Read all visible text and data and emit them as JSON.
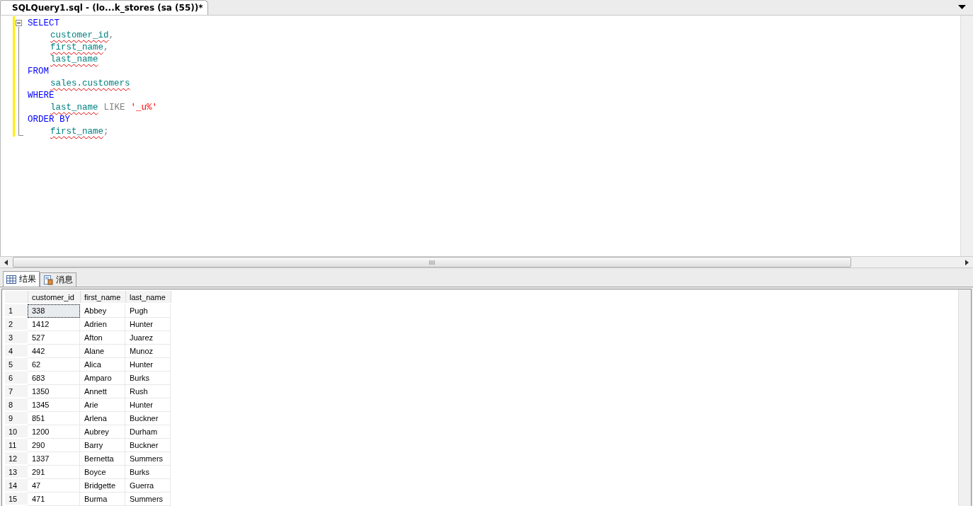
{
  "document_tab": {
    "title": "SQLQuery1.sql - (lo...k_stores (sa (55))*",
    "selected": true
  },
  "editor": {
    "folded": false,
    "lines": [
      {
        "indent": false,
        "tokens": [
          {
            "kind": "keyword",
            "text": "SELECT"
          }
        ]
      },
      {
        "indent": true,
        "tokens": [
          {
            "kind": "identifier",
            "text": "customer_id"
          },
          {
            "kind": "punct",
            "text": ","
          }
        ]
      },
      {
        "indent": true,
        "tokens": [
          {
            "kind": "identifier",
            "text": "first_name"
          },
          {
            "kind": "punct",
            "text": ","
          }
        ]
      },
      {
        "indent": true,
        "tokens": [
          {
            "kind": "identifier",
            "text": "last_name"
          }
        ]
      },
      {
        "indent": false,
        "tokens": [
          {
            "kind": "keyword",
            "text": "FROM"
          }
        ]
      },
      {
        "indent": true,
        "tokens": [
          {
            "kind": "identifier",
            "text": "sales.customers"
          }
        ]
      },
      {
        "indent": false,
        "tokens": [
          {
            "kind": "keyword",
            "text": "WHERE"
          }
        ]
      },
      {
        "indent": true,
        "tokens": [
          {
            "kind": "identifier",
            "text": "last_name"
          },
          {
            "kind": "operator",
            "text": "LIKE"
          },
          {
            "kind": "string",
            "text": "'_u%'"
          }
        ]
      },
      {
        "indent": false,
        "tokens": [
          {
            "kind": "keyword",
            "text": "ORDER BY"
          }
        ]
      },
      {
        "indent": true,
        "tokens": [
          {
            "kind": "identifier",
            "text": "first_name"
          },
          {
            "kind": "punct",
            "text": ";"
          }
        ]
      }
    ]
  },
  "result_tabs": [
    {
      "label": "结果",
      "kind": "grid",
      "selected": true
    },
    {
      "label": "消息",
      "kind": "messages",
      "selected": false
    }
  ],
  "grid": {
    "columns": [
      "customer_id",
      "first_name",
      "last_name"
    ],
    "rows": [
      {
        "number": "1",
        "cells": [
          "338",
          "Abbey",
          "Pugh"
        ],
        "focused": true
      },
      {
        "number": "2",
        "cells": [
          "1412",
          "Adrien",
          "Hunter"
        ],
        "focused": false
      },
      {
        "number": "3",
        "cells": [
          "527",
          "Afton",
          "Juarez"
        ],
        "focused": false
      },
      {
        "number": "4",
        "cells": [
          "442",
          "Alane",
          "Munoz"
        ],
        "focused": false
      },
      {
        "number": "5",
        "cells": [
          "62",
          "Alica",
          "Hunter"
        ],
        "focused": false
      },
      {
        "number": "6",
        "cells": [
          "683",
          "Amparo",
          "Burks"
        ],
        "focused": false
      },
      {
        "number": "7",
        "cells": [
          "1350",
          "Annett",
          "Rush"
        ],
        "focused": false
      },
      {
        "number": "8",
        "cells": [
          "1345",
          "Arie",
          "Hunter"
        ],
        "focused": false
      },
      {
        "number": "9",
        "cells": [
          "851",
          "Arlena",
          "Buckner"
        ],
        "focused": false
      },
      {
        "number": "10",
        "cells": [
          "1200",
          "Aubrey",
          "Durham"
        ],
        "focused": false
      },
      {
        "number": "11",
        "cells": [
          "290",
          "Barry",
          "Buckner"
        ],
        "focused": false
      },
      {
        "number": "12",
        "cells": [
          "1337",
          "Bernetta",
          "Summers"
        ],
        "focused": false
      },
      {
        "number": "13",
        "cells": [
          "291",
          "Boyce",
          "Burks"
        ],
        "focused": false
      },
      {
        "number": "14",
        "cells": [
          "47",
          "Bridgette",
          "Guerra"
        ],
        "focused": false
      },
      {
        "number": "15",
        "cells": [
          "471",
          "Burma",
          "Summers"
        ],
        "focused": false
      }
    ]
  }
}
